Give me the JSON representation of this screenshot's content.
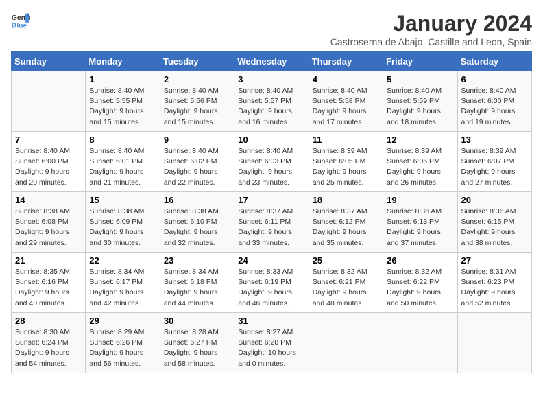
{
  "logo": {
    "text_general": "General",
    "text_blue": "Blue"
  },
  "title": "January 2024",
  "subtitle": "Castroserna de Abajo, Castille and Leon, Spain",
  "days_of_week": [
    "Sunday",
    "Monday",
    "Tuesday",
    "Wednesday",
    "Thursday",
    "Friday",
    "Saturday"
  ],
  "weeks": [
    [
      {
        "day": "",
        "sunrise": "",
        "sunset": "",
        "daylight": ""
      },
      {
        "day": "1",
        "sunrise": "Sunrise: 8:40 AM",
        "sunset": "Sunset: 5:55 PM",
        "daylight": "Daylight: 9 hours and 15 minutes."
      },
      {
        "day": "2",
        "sunrise": "Sunrise: 8:40 AM",
        "sunset": "Sunset: 5:56 PM",
        "daylight": "Daylight: 9 hours and 15 minutes."
      },
      {
        "day": "3",
        "sunrise": "Sunrise: 8:40 AM",
        "sunset": "Sunset: 5:57 PM",
        "daylight": "Daylight: 9 hours and 16 minutes."
      },
      {
        "day": "4",
        "sunrise": "Sunrise: 8:40 AM",
        "sunset": "Sunset: 5:58 PM",
        "daylight": "Daylight: 9 hours and 17 minutes."
      },
      {
        "day": "5",
        "sunrise": "Sunrise: 8:40 AM",
        "sunset": "Sunset: 5:59 PM",
        "daylight": "Daylight: 9 hours and 18 minutes."
      },
      {
        "day": "6",
        "sunrise": "Sunrise: 8:40 AM",
        "sunset": "Sunset: 6:00 PM",
        "daylight": "Daylight: 9 hours and 19 minutes."
      }
    ],
    [
      {
        "day": "7",
        "sunrise": "Sunrise: 8:40 AM",
        "sunset": "Sunset: 6:00 PM",
        "daylight": "Daylight: 9 hours and 20 minutes."
      },
      {
        "day": "8",
        "sunrise": "Sunrise: 8:40 AM",
        "sunset": "Sunset: 6:01 PM",
        "daylight": "Daylight: 9 hours and 21 minutes."
      },
      {
        "day": "9",
        "sunrise": "Sunrise: 8:40 AM",
        "sunset": "Sunset: 6:02 PM",
        "daylight": "Daylight: 9 hours and 22 minutes."
      },
      {
        "day": "10",
        "sunrise": "Sunrise: 8:40 AM",
        "sunset": "Sunset: 6:03 PM",
        "daylight": "Daylight: 9 hours and 23 minutes."
      },
      {
        "day": "11",
        "sunrise": "Sunrise: 8:39 AM",
        "sunset": "Sunset: 6:05 PM",
        "daylight": "Daylight: 9 hours and 25 minutes."
      },
      {
        "day": "12",
        "sunrise": "Sunrise: 8:39 AM",
        "sunset": "Sunset: 6:06 PM",
        "daylight": "Daylight: 9 hours and 26 minutes."
      },
      {
        "day": "13",
        "sunrise": "Sunrise: 8:39 AM",
        "sunset": "Sunset: 6:07 PM",
        "daylight": "Daylight: 9 hours and 27 minutes."
      }
    ],
    [
      {
        "day": "14",
        "sunrise": "Sunrise: 8:38 AM",
        "sunset": "Sunset: 6:08 PM",
        "daylight": "Daylight: 9 hours and 29 minutes."
      },
      {
        "day": "15",
        "sunrise": "Sunrise: 8:38 AM",
        "sunset": "Sunset: 6:09 PM",
        "daylight": "Daylight: 9 hours and 30 minutes."
      },
      {
        "day": "16",
        "sunrise": "Sunrise: 8:38 AM",
        "sunset": "Sunset: 6:10 PM",
        "daylight": "Daylight: 9 hours and 32 minutes."
      },
      {
        "day": "17",
        "sunrise": "Sunrise: 8:37 AM",
        "sunset": "Sunset: 6:11 PM",
        "daylight": "Daylight: 9 hours and 33 minutes."
      },
      {
        "day": "18",
        "sunrise": "Sunrise: 8:37 AM",
        "sunset": "Sunset: 6:12 PM",
        "daylight": "Daylight: 9 hours and 35 minutes."
      },
      {
        "day": "19",
        "sunrise": "Sunrise: 8:36 AM",
        "sunset": "Sunset: 6:13 PM",
        "daylight": "Daylight: 9 hours and 37 minutes."
      },
      {
        "day": "20",
        "sunrise": "Sunrise: 8:36 AM",
        "sunset": "Sunset: 6:15 PM",
        "daylight": "Daylight: 9 hours and 38 minutes."
      }
    ],
    [
      {
        "day": "21",
        "sunrise": "Sunrise: 8:35 AM",
        "sunset": "Sunset: 6:16 PM",
        "daylight": "Daylight: 9 hours and 40 minutes."
      },
      {
        "day": "22",
        "sunrise": "Sunrise: 8:34 AM",
        "sunset": "Sunset: 6:17 PM",
        "daylight": "Daylight: 9 hours and 42 minutes."
      },
      {
        "day": "23",
        "sunrise": "Sunrise: 8:34 AM",
        "sunset": "Sunset: 6:18 PM",
        "daylight": "Daylight: 9 hours and 44 minutes."
      },
      {
        "day": "24",
        "sunrise": "Sunrise: 8:33 AM",
        "sunset": "Sunset: 6:19 PM",
        "daylight": "Daylight: 9 hours and 46 minutes."
      },
      {
        "day": "25",
        "sunrise": "Sunrise: 8:32 AM",
        "sunset": "Sunset: 6:21 PM",
        "daylight": "Daylight: 9 hours and 48 minutes."
      },
      {
        "day": "26",
        "sunrise": "Sunrise: 8:32 AM",
        "sunset": "Sunset: 6:22 PM",
        "daylight": "Daylight: 9 hours and 50 minutes."
      },
      {
        "day": "27",
        "sunrise": "Sunrise: 8:31 AM",
        "sunset": "Sunset: 6:23 PM",
        "daylight": "Daylight: 9 hours and 52 minutes."
      }
    ],
    [
      {
        "day": "28",
        "sunrise": "Sunrise: 8:30 AM",
        "sunset": "Sunset: 6:24 PM",
        "daylight": "Daylight: 9 hours and 54 minutes."
      },
      {
        "day": "29",
        "sunrise": "Sunrise: 8:29 AM",
        "sunset": "Sunset: 6:26 PM",
        "daylight": "Daylight: 9 hours and 56 minutes."
      },
      {
        "day": "30",
        "sunrise": "Sunrise: 8:28 AM",
        "sunset": "Sunset: 6:27 PM",
        "daylight": "Daylight: 9 hours and 58 minutes."
      },
      {
        "day": "31",
        "sunrise": "Sunrise: 8:27 AM",
        "sunset": "Sunset: 6:28 PM",
        "daylight": "Daylight: 10 hours and 0 minutes."
      },
      {
        "day": "",
        "sunrise": "",
        "sunset": "",
        "daylight": ""
      },
      {
        "day": "",
        "sunrise": "",
        "sunset": "",
        "daylight": ""
      },
      {
        "day": "",
        "sunrise": "",
        "sunset": "",
        "daylight": ""
      }
    ]
  ]
}
